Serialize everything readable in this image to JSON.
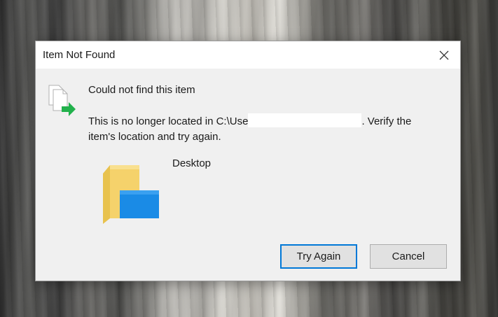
{
  "dialog": {
    "title": "Item Not Found",
    "close_icon": "close-icon",
    "heading": "Could not find this item",
    "message_before": "This is no longer located in C:\\Use",
    "message_after": ". Verify the item's location and try again.",
    "item_icon": "folder-icon",
    "item_name": "Desktop",
    "status_icon": "file-move-icon"
  },
  "buttons": {
    "try_again": "Try Again",
    "cancel": "Cancel"
  },
  "colors": {
    "accent": "#0078d7",
    "arrow": "#22b14c",
    "folder": "#f5d26b"
  }
}
